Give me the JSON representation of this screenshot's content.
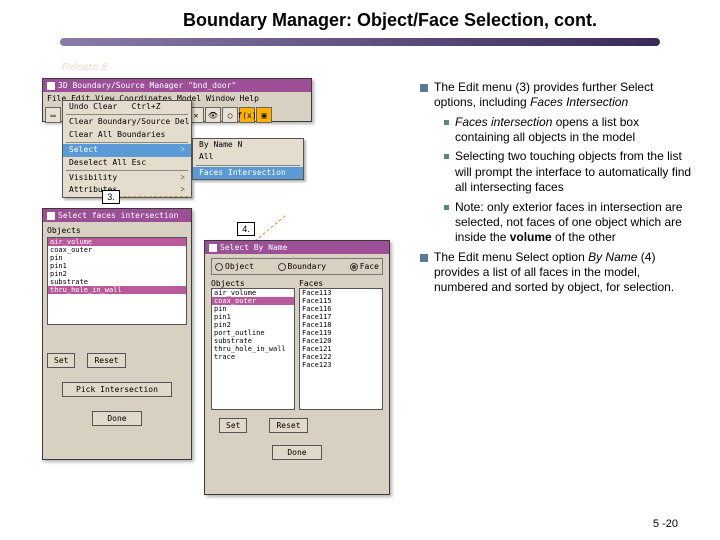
{
  "title": "Boundary Manager: Object/Face Selection, cont.",
  "release": "Release 8",
  "page_number": "5 -20",
  "callouts": {
    "c3": "3.",
    "c4": "4."
  },
  "main_window": {
    "title": "3D Boundary/Source Manager \"bnd_door\"",
    "menubar": "File  Edit  View  Coordinates  Model  Window  Help"
  },
  "edit_menu": {
    "undo": "Undo Clear",
    "undo_accel": "Ctrl+Z",
    "clear_bs": "Clear Boundary/Source   Del",
    "clear_all": "Clear All Boundaries",
    "select": "Select",
    "deselect": "Deselect All        Esc",
    "visibility": "Visibility",
    "attributes": "Attributes"
  },
  "select_submenu": {
    "by_name": "By Name              N",
    "all": "All",
    "faces_intersection": "Faces Intersection"
  },
  "faces_window": {
    "title": "Select faces intersection",
    "col_label": "Objects",
    "items": [
      "air_volume",
      "coax_outer",
      "pin",
      "pin1",
      "pin2",
      "substrate",
      "thru_hole_in_wall"
    ],
    "btn_set": "Set",
    "btn_reset": "Reset",
    "btn_pick": "Pick Intersection",
    "btn_done": "Done"
  },
  "byname_window": {
    "title": "Select By Name",
    "radio_object": "Object",
    "radio_boundary": "Boundary",
    "radio_face": "Face",
    "col_objects": "Objects",
    "col_faces": "Faces",
    "objects": [
      "air_volume",
      "coax_outer",
      "pin",
      "pin1",
      "pin2",
      "port_outline",
      "substrate",
      "thru_hole_in_wall",
      "trace"
    ],
    "faces": [
      "Face113",
      "Face115",
      "Face116",
      "Face117",
      "Face118",
      "Face119",
      "Face120",
      "Face121",
      "Face122",
      "Face123"
    ],
    "btn_set": "Set",
    "btn_reset": "Reset",
    "btn_done": "Done"
  },
  "bullets": {
    "b1_a": "The Edit menu (3) provides further Select options, including ",
    "b1_b": "Faces Intersection",
    "s1_a": "Faces intersection",
    "s1_b": " opens a list box containing all objects in the model",
    "s2": "Selecting two touching objects from the list will prompt the interface to automatically find all intersecting faces",
    "s3_a": "Note: only exterior faces in intersection are selected, not faces of one object which are inside the ",
    "s3_b": "volume",
    "s3_c": " of the other",
    "b2_a": "The Edit menu Select option ",
    "b2_b": "By Name",
    "b2_c": " (4) provides a list of all faces in the model, numbered and sorted by object, for selection."
  }
}
